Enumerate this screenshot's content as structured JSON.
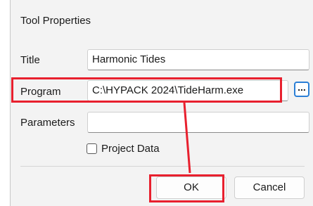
{
  "dialog": {
    "title": "Tool Properties"
  },
  "form": {
    "title_label": "Title",
    "title_value": "Harmonic Tides",
    "program_label": "Program",
    "program_value": "C:\\HYPACK 2024\\TideHarm.exe",
    "browse_label": "...",
    "parameters_label": "Parameters",
    "parameters_value": "",
    "project_data_label": "Project Data",
    "project_data_checked": false
  },
  "buttons": {
    "ok_label": "OK",
    "cancel_label": "Cancel"
  },
  "annotation": {
    "color": "#e8202e"
  }
}
